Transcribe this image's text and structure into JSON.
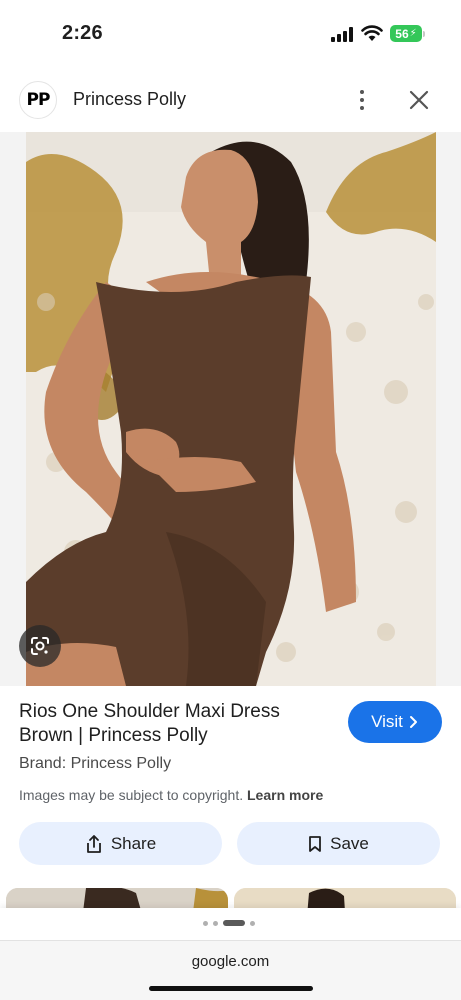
{
  "status_bar": {
    "time": "2:26",
    "battery": "56"
  },
  "site": {
    "logo_text": "PP",
    "name": "Princess Polly"
  },
  "image": {
    "icon": "google-lens-icon",
    "colors": {
      "dress": "#5b3d2b",
      "sofa": "#efeae2",
      "gold_frame": "#b8913a"
    }
  },
  "product": {
    "title": "Rios One Shoulder Maxi Dress Brown | Princess Polly",
    "brand": "Brand: Princess Polly",
    "copyright_text": "Images may be subject to copyright.",
    "learn_more": "Learn more"
  },
  "buttons": {
    "visit": "Visit",
    "share": "Share",
    "save": "Save"
  },
  "colors": {
    "accent": "#1a73e8",
    "action_bg": "#e8f0fe"
  },
  "browser": {
    "url": "google.com"
  }
}
